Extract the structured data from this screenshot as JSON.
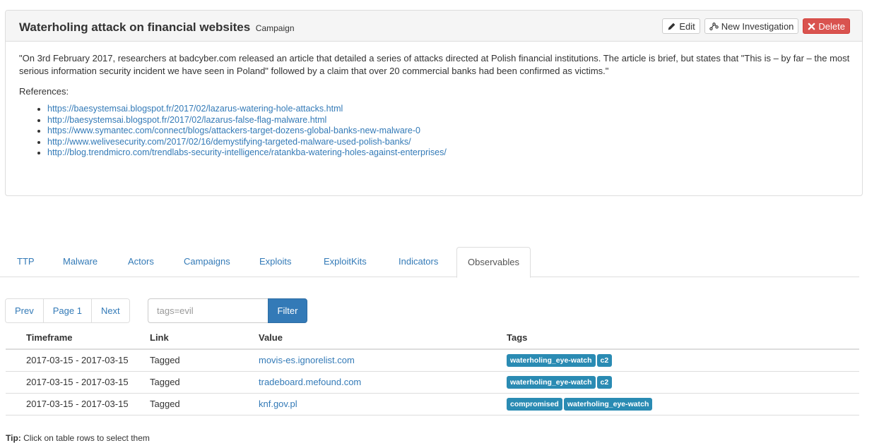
{
  "campaign": {
    "title": "Waterholing attack on financial websites",
    "type": "Campaign",
    "buttons": {
      "edit": "Edit",
      "new_investigation": "New Investigation",
      "delete": "Delete"
    },
    "description": "\"On 3rd February 2017, researchers at badcyber.com released an article that detailed a series of attacks directed at Polish financial institutions. The article is brief, but states that \"This is – by far – the most serious information security incident we have seen in Poland\" followed by a claim that over 20 commercial banks had been confirmed as victims.\"",
    "references_label": "References:",
    "references": [
      "https://baesystemsai.blogspot.fr/2017/02/lazarus-watering-hole-attacks.html",
      "http://baesystemsai.blogspot.fr/2017/02/lazarus-false-flag-malware.html",
      "https://www.symantec.com/connect/blogs/attackers-target-dozens-global-banks-new-malware-0",
      "http://www.welivesecurity.com/2017/02/16/demystifying-targeted-malware-used-polish-banks/",
      "http://blog.trendmicro.com/trendlabs-security-intelligence/ratankba-watering-holes-against-enterprises/"
    ]
  },
  "tabs": [
    "TTP",
    "Malware",
    "Actors",
    "Campaigns",
    "Exploits",
    "ExploitKits",
    "Indicators",
    "Observables"
  ],
  "active_tab": "Observables",
  "pager": {
    "prev": "Prev",
    "page": "Page 1",
    "next": "Next"
  },
  "search": {
    "placeholder": "tags=evil",
    "value": "",
    "button": "Filter"
  },
  "table": {
    "columns": [
      "Timeframe",
      "Link",
      "Value",
      "Tags"
    ],
    "rows": [
      {
        "timeframe": "2017-03-15 - 2017-03-15",
        "link": "Tagged",
        "value": "movis-es.ignorelist.com",
        "tags": [
          "waterholing_eye-watch",
          "c2"
        ]
      },
      {
        "timeframe": "2017-03-15 - 2017-03-15",
        "link": "Tagged",
        "value": "tradeboard.mefound.com",
        "tags": [
          "waterholing_eye-watch",
          "c2"
        ]
      },
      {
        "timeframe": "2017-03-15 - 2017-03-15",
        "link": "Tagged",
        "value": "knf.gov.pl",
        "tags": [
          "compromised",
          "waterholing_eye-watch"
        ]
      }
    ]
  },
  "tip": {
    "label": "Tip:",
    "text": "Click on table rows to select them"
  },
  "colors": {
    "link": "#337ab7",
    "tag": "#2a8bb3",
    "danger": "#d9534f",
    "primary": "#337ab7"
  },
  "icons": {
    "edit": "pencil-icon",
    "new_investigation": "graph-icon",
    "delete": "close-icon"
  }
}
